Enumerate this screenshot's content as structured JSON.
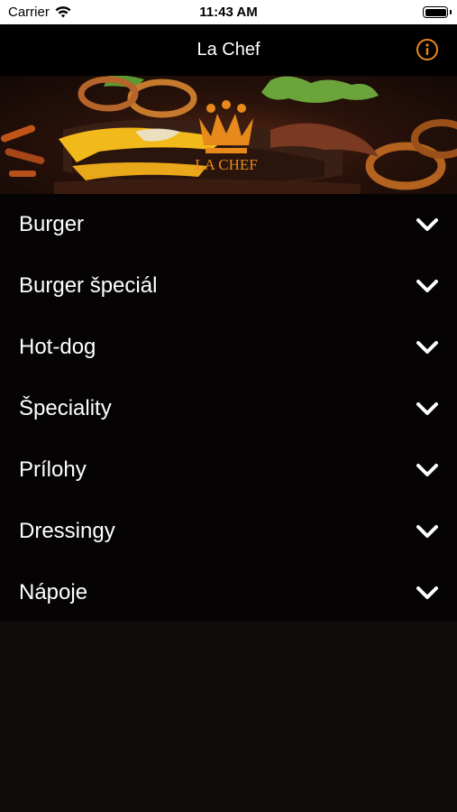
{
  "status_bar": {
    "carrier": "Carrier",
    "time": "11:43 AM"
  },
  "nav": {
    "title": "La Chef",
    "info_icon": "info-icon",
    "accent_color": "#e8891c"
  },
  "hero": {
    "logo_text": "LA CHEF"
  },
  "menu": {
    "items": [
      {
        "label": "Burger"
      },
      {
        "label": "Burger špeciál"
      },
      {
        "label": "Hot-dog"
      },
      {
        "label": "Špeciality"
      },
      {
        "label": "Prílohy"
      },
      {
        "label": "Dressingy"
      },
      {
        "label": "Nápoje"
      }
    ],
    "expand_icon": "chevron-down-icon"
  }
}
